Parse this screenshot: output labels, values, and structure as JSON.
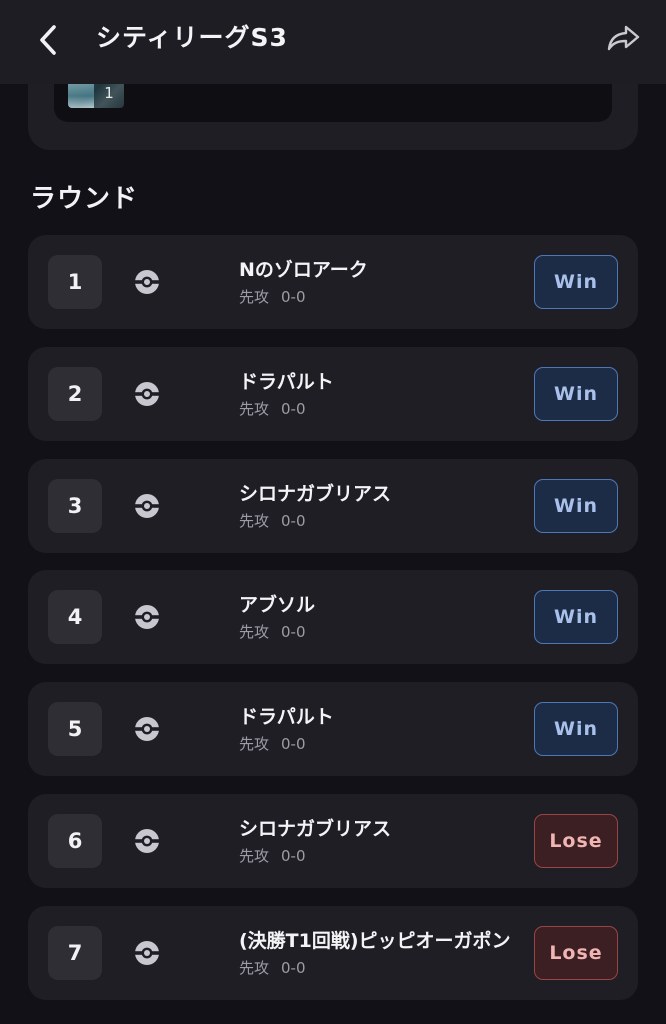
{
  "header": {
    "title": "シティリーグS3",
    "back_icon": "chevron-left-icon",
    "share_icon": "share-icon"
  },
  "deck": {
    "count": "1"
  },
  "rounds_section": {
    "title": "ラウンド"
  },
  "colors": {
    "win_bg": "#1d2c46",
    "win_border": "#4e77b8",
    "lose_bg": "#3b1f22",
    "lose_border": "#9a4444"
  },
  "rounds": [
    {
      "number": "1",
      "opponent": "Nのゾロアーク",
      "turn": "先攻",
      "score": "0-0",
      "result": "Win"
    },
    {
      "number": "2",
      "opponent": "ドラパルト",
      "turn": "先攻",
      "score": "0-0",
      "result": "Win"
    },
    {
      "number": "3",
      "opponent": "シロナガブリアス",
      "turn": "先攻",
      "score": "0-0",
      "result": "Win"
    },
    {
      "number": "4",
      "opponent": "アブソル",
      "turn": "先攻",
      "score": "0-0",
      "result": "Win"
    },
    {
      "number": "5",
      "opponent": "ドラパルト",
      "turn": "先攻",
      "score": "0-0",
      "result": "Win"
    },
    {
      "number": "6",
      "opponent": "シロナガブリアス",
      "turn": "先攻",
      "score": "0-0",
      "result": "Lose"
    },
    {
      "number": "7",
      "opponent": "(決勝T1回戦)ピッピオーガポン",
      "turn": "先攻",
      "score": "0-0",
      "result": "Lose"
    }
  ]
}
